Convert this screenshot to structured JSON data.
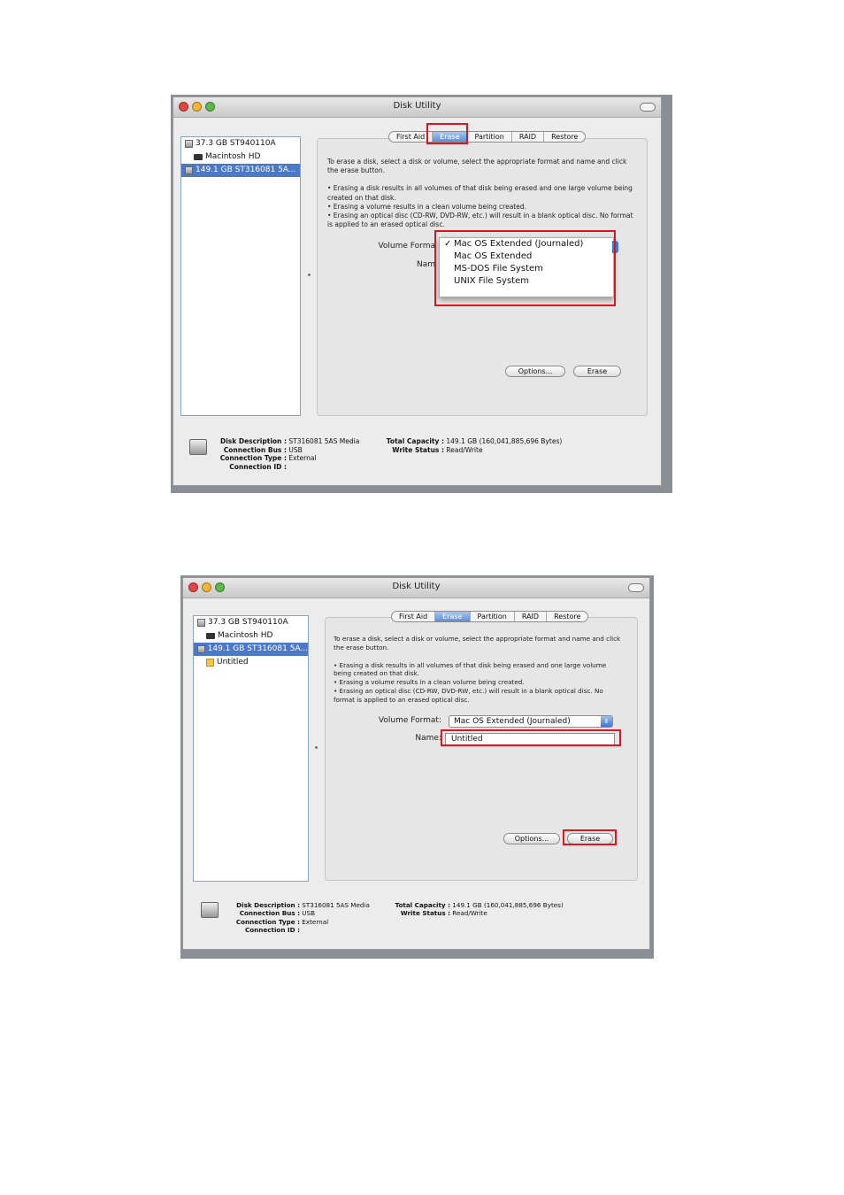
{
  "colors": {
    "accent_red": "#e0141e",
    "selection_blue": "#4c79c7",
    "close": "#e2463f",
    "minimize": "#f2b632",
    "zoom": "#5db94a"
  },
  "screens": [
    {
      "window_title": "Disk Utility",
      "tabs": [
        {
          "label": "First Aid",
          "selected": false
        },
        {
          "label": "Erase",
          "selected": true
        },
        {
          "label": "Partition",
          "selected": false
        },
        {
          "label": "RAID",
          "selected": false
        },
        {
          "label": "Restore",
          "selected": false
        }
      ],
      "sidebar": [
        {
          "label": "37.3 GB ST940110A",
          "icon": "disk-icon",
          "selected": false
        },
        {
          "label": "Macintosh HD",
          "icon": "volume-icon",
          "selected": false
        },
        {
          "label": "149.1 GB ST316081 5A...",
          "icon": "disk-icon",
          "selected": true
        }
      ],
      "description": {
        "intro": "To erase a disk, select a disk or volume, select the appropriate format and name and click the erase button.",
        "bullets": [
          "• Erasing a disk results in all volumes of that disk being erased and one large volume being created on that disk.",
          "• Erasing a volume results in a clean volume being created.",
          "• Erasing an optical disc (CD-RW, DVD-RW, etc.) will result in a blank optical disc.  No format is applied to an erased optical disc."
        ]
      },
      "volume_format_label": "Volume Forma",
      "name_label": "Nam",
      "format_menu": {
        "checkmark": "✓",
        "items": [
          "Mac OS Extended (Journaled)",
          "Mac OS Extended",
          "MS-DOS File System",
          "UNIX File System"
        ]
      },
      "buttons": {
        "options": "Options...",
        "erase": "Erase"
      },
      "info": {
        "disk_description_label": "Disk Description :",
        "disk_description": "ST316081 5AS Media",
        "connection_bus_label": "Connection Bus :",
        "connection_bus": "USB",
        "connection_type_label": "Connection Type :",
        "connection_type": "External",
        "connection_id_label": "Connection ID :",
        "connection_id": "",
        "total_capacity_label": "Total Capacity :",
        "total_capacity": "149.1 GB (160,041,885,696 Bytes)",
        "write_status_label": "Write Status :",
        "write_status": "Read/Write"
      }
    },
    {
      "window_title": "Disk Utility",
      "tabs": [
        {
          "label": "First Aid",
          "selected": false
        },
        {
          "label": "Erase",
          "selected": true
        },
        {
          "label": "Partition",
          "selected": false
        },
        {
          "label": "RAID",
          "selected": false
        },
        {
          "label": "Restore",
          "selected": false
        }
      ],
      "sidebar": [
        {
          "label": "37.3 GB ST940110A",
          "icon": "disk-icon",
          "selected": false
        },
        {
          "label": "Macintosh HD",
          "icon": "volume-icon",
          "selected": false
        },
        {
          "label": "149.1 GB ST316081 5A...",
          "icon": "disk-icon",
          "selected": true
        },
        {
          "label": "Untitled",
          "icon": "folder-volume-icon",
          "selected": false
        }
      ],
      "description": {
        "intro": "To erase a disk, select a disk or volume, select the appropriate format and name and click the erase button.",
        "bullets": [
          "• Erasing a disk results in all volumes of that disk being erased and one large volume being created on that disk.",
          "• Erasing a volume results in a clean volume being created.",
          "• Erasing an optical disc (CD-RW, DVD-RW, etc.) will result in a blank optical disc.  No format is applied to an erased optical disc."
        ]
      },
      "volume_format_label": "Volume Format:",
      "volume_format_value": "Mac OS Extended (Journaled)",
      "name_label": "Name:",
      "name_value": "Untitled",
      "buttons": {
        "options": "Options...",
        "erase": "Erase"
      },
      "info": {
        "disk_description_label": "Disk Description :",
        "disk_description": "ST316081 5AS Media",
        "connection_bus_label": "Connection Bus :",
        "connection_bus": "USB",
        "connection_type_label": "Connection Type :",
        "connection_type": "External",
        "connection_id_label": "Connection ID :",
        "connection_id": "",
        "total_capacity_label": "Total Capacity :",
        "total_capacity": "149.1 GB (160,041,885,696 Bytes)",
        "write_status_label": "Write Status :",
        "write_status": "Read/Write"
      }
    }
  ]
}
